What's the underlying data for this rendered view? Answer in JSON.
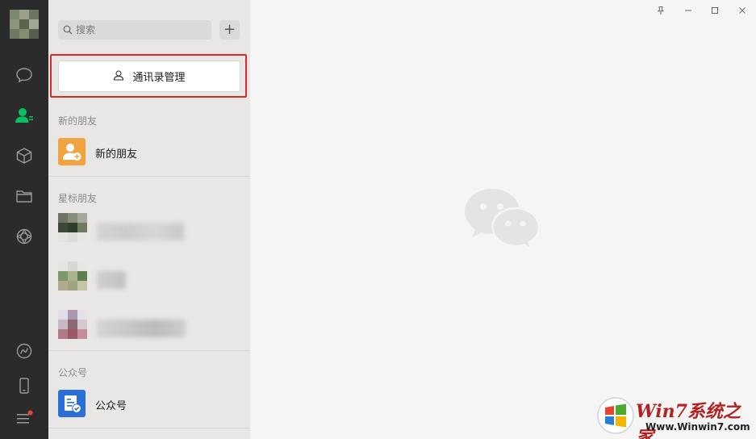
{
  "colors": {
    "nav_bg": "#2b2b2b",
    "panel_bg": "#e9e7e6",
    "main_bg": "#f5f5f5",
    "accent_green": "#07c160",
    "highlight_red": "#d72b2b",
    "new_friend_orange": "#f1a33f",
    "official_blue": "#2a6fd6"
  },
  "nav": {
    "icons": [
      "chat-icon",
      "contacts-icon",
      "favorites-icon",
      "folder-icon",
      "moments-icon",
      "channels-icon",
      "phone-icon",
      "menu-icon"
    ],
    "active": "contacts-icon"
  },
  "search": {
    "placeholder": "搜索",
    "value": ""
  },
  "add_button": {
    "symbol": "+"
  },
  "manage_button": {
    "label": "通讯录管理"
  },
  "sections": {
    "new_friends": {
      "header": "新的朋友",
      "item_label": "新的朋友"
    },
    "starred": {
      "header": "星标朋友"
    },
    "official": {
      "header": "公众号",
      "item_label": "公众号"
    }
  },
  "watermark": {
    "title": "Win7系统之家",
    "url": "Www.Winwin7.com"
  }
}
